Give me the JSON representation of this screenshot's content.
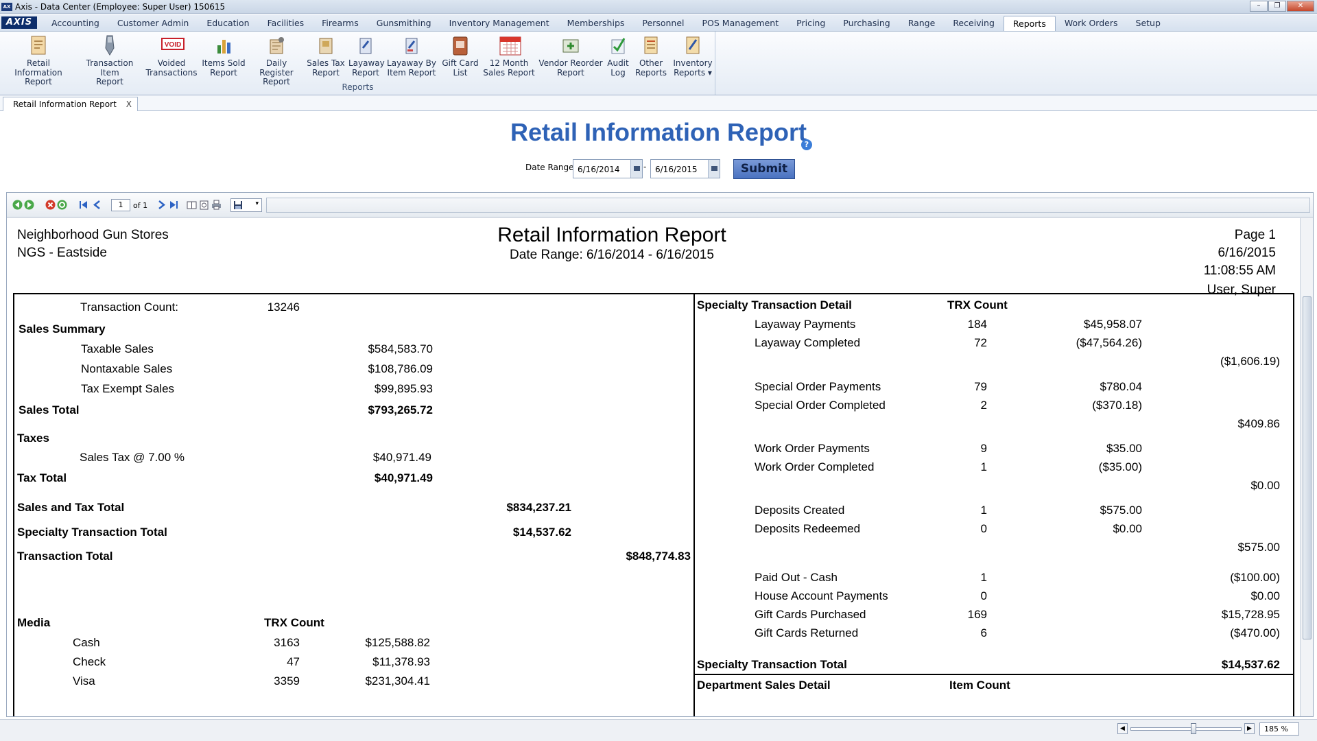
{
  "window": {
    "title": "Axis - Data Center  (Employee: Super User) 150615",
    "logo": "AXIS"
  },
  "menu": [
    "Accounting",
    "Customer Admin",
    "Education",
    "Facilities",
    "Firearms",
    "Gunsmithing",
    "Inventory Management",
    "Memberships",
    "Personnel",
    "POS Management",
    "Pricing",
    "Purchasing",
    "Range",
    "Receiving",
    "Reports",
    "Work Orders",
    "Setup"
  ],
  "menu_active": "Reports",
  "ribbon": {
    "group_label": "Reports",
    "buttons": [
      {
        "l1": "Retail Information",
        "l2": "Report"
      },
      {
        "l1": "Transaction Item",
        "l2": "Report"
      },
      {
        "l1": "Voided",
        "l2": "Transactions",
        "badge": "VOID"
      },
      {
        "l1": "Items Sold",
        "l2": "Report"
      },
      {
        "l1": "Daily Register",
        "l2": "Report"
      },
      {
        "l1": "Sales Tax",
        "l2": "Report"
      },
      {
        "l1": "Layaway",
        "l2": "Report"
      },
      {
        "l1": "Layaway By",
        "l2": "Item Report"
      },
      {
        "l1": "Gift Card",
        "l2": "List"
      },
      {
        "l1": "12 Month",
        "l2": "Sales Report"
      },
      {
        "l1": "Vendor Reorder",
        "l2": "Report"
      },
      {
        "l1": "Audit",
        "l2": "Log"
      },
      {
        "l1": "Other",
        "l2": "Reports"
      },
      {
        "l1": "Inventory",
        "l2": "Reports ▾"
      }
    ]
  },
  "doc_tab": {
    "label": "Retail Information Report",
    "close": "X"
  },
  "page": {
    "title": "Retail Information Report",
    "help": "?",
    "date_range_label": "Date Range:",
    "date_from": "6/16/2014",
    "date_sep": "-",
    "date_to": "6/16/2015",
    "submit": "Submit"
  },
  "viewer": {
    "page_input": "1",
    "page_of": "of 1",
    "zoom": "185 %"
  },
  "report": {
    "store": "Neighborhood Gun Stores",
    "location": "NGS - Eastside",
    "title": "Retail Information Report",
    "date_range": "Date Range: 6/16/2014 - 6/16/2015",
    "page": "Page 1",
    "date": "6/16/2015",
    "time": "11:08:55 AM",
    "user": "User, Super",
    "left": {
      "trx_count_label": "Transaction Count:",
      "trx_count": "13246",
      "sales_summary": "Sales Summary",
      "taxable_label": "Taxable Sales",
      "taxable": "$584,583.70",
      "nontaxable_label": "Nontaxable Sales",
      "nontaxable": "$108,786.09",
      "exempt_label": "Tax Exempt Sales",
      "exempt": "$99,895.93",
      "sales_total_label": "Sales Total",
      "sales_total": "$793,265.72",
      "taxes": "Taxes",
      "sales_tax_label": "Sales Tax @ 7.00 %",
      "sales_tax": "$40,971.49",
      "tax_total_label": "Tax Total",
      "tax_total": "$40,971.49",
      "sales_tax_total_label": "Sales and Tax Total",
      "sales_tax_total": "$834,237.21",
      "specialty_total_label": "Specialty Transaction Total",
      "specialty_total": "$14,537.62",
      "transaction_total_label": "Transaction Total",
      "transaction_total": "$848,774.83",
      "media_label": "Media",
      "trx_count_col": "TRX Count",
      "media": [
        {
          "name": "Cash",
          "count": "3163",
          "amount": "$125,588.82"
        },
        {
          "name": "Check",
          "count": "47",
          "amount": "$11,378.93"
        },
        {
          "name": "Visa",
          "count": "3359",
          "amount": "$231,304.41"
        }
      ]
    },
    "right": {
      "header": "Specialty Transaction Detail",
      "trx_col": "TRX Count",
      "rows": [
        {
          "label": "Layaway Payments",
          "count": "184",
          "amount": "$45,958.07"
        },
        {
          "label": "Layaway Completed",
          "count": "72",
          "amount": "($47,564.26)"
        },
        {
          "subtotal": "($1,606.19)"
        },
        {
          "label": "Special Order Payments",
          "count": "79",
          "amount": "$780.04"
        },
        {
          "label": "Special Order Completed",
          "count": "2",
          "amount": "($370.18)"
        },
        {
          "subtotal": "$409.86"
        },
        {
          "label": "Work Order Payments",
          "count": "9",
          "amount": "$35.00"
        },
        {
          "label": "Work Order Completed",
          "count": "1",
          "amount": "($35.00)"
        },
        {
          "subtotal": "$0.00"
        },
        {
          "label": "Deposits Created",
          "count": "1",
          "amount": "$575.00"
        },
        {
          "label": "Deposits Redeemed",
          "count": "0",
          "amount": "$0.00"
        },
        {
          "subtotal": "$575.00"
        },
        {
          "label": "Paid Out - Cash",
          "count": "1",
          "total": "($100.00)"
        },
        {
          "label": "House Account Payments",
          "count": "0",
          "total": "$0.00"
        },
        {
          "label": "Gift Cards Purchased",
          "count": "169",
          "total": "$15,728.95"
        },
        {
          "label": "Gift Cards Returned",
          "count": "6",
          "total": "($470.00)"
        }
      ],
      "specialty_total_label": "Specialty Transaction Total",
      "specialty_total": "$14,537.62",
      "dept_header": "Department Sales Detail",
      "item_count_col": "Item Count"
    }
  },
  "colors": {
    "title_blue": "#2e62b6",
    "ribbon_bg": "#e5ecf5",
    "submit": "#4a72c0"
  },
  "icons": [
    "back-icon",
    "forward-icon",
    "stop-icon",
    "refresh-icon",
    "first-page-icon",
    "prev-page-icon",
    "next-page-icon",
    "last-page-icon",
    "print-layout-icon",
    "page-setup-icon",
    "print-icon",
    "save-icon"
  ]
}
